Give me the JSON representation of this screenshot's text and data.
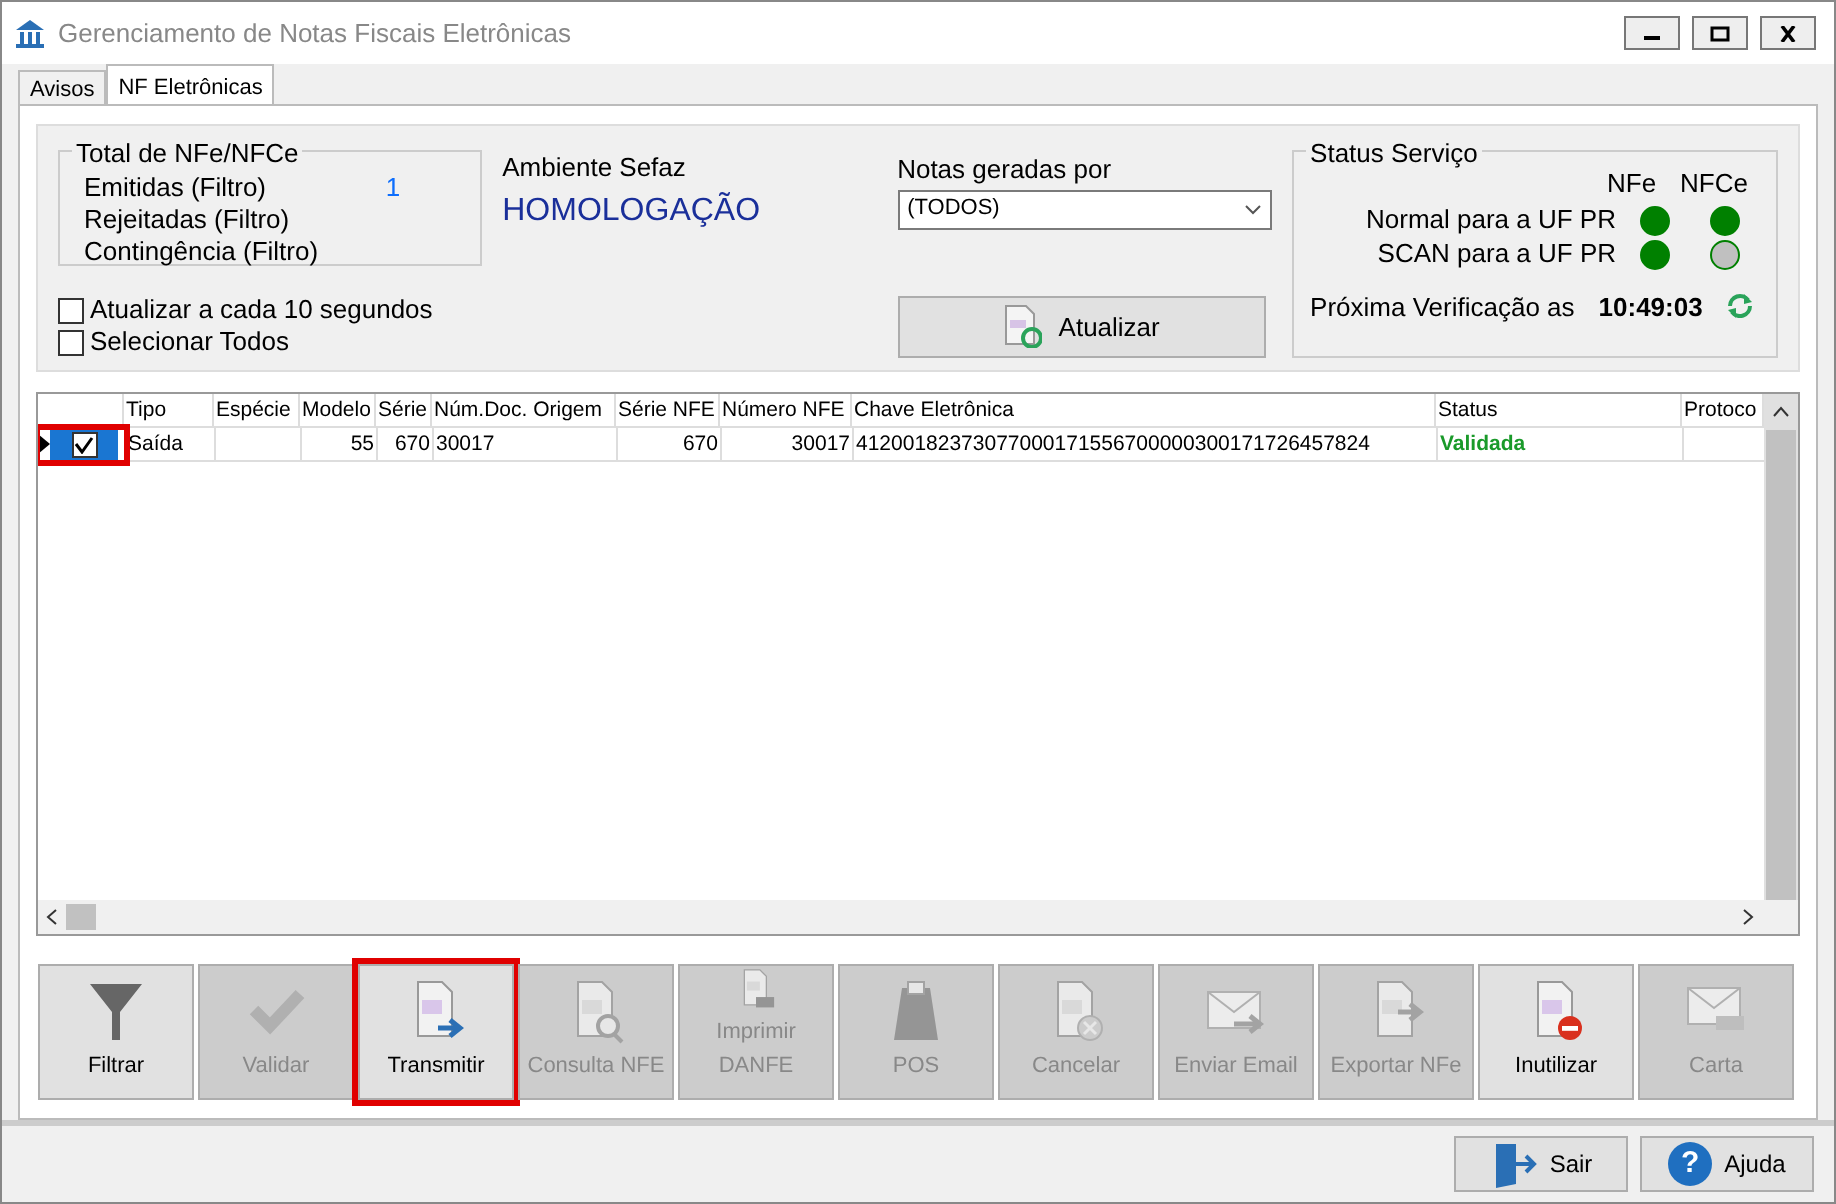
{
  "window": {
    "title": "Gerenciamento de Notas Fiscais Eletrônicas"
  },
  "tabs": [
    {
      "label": "Avisos",
      "selected": false
    },
    {
      "label": "NF Eletrônicas",
      "selected": true
    }
  ],
  "totals": {
    "title": "Total de NFe/NFCe",
    "rows": [
      {
        "label": "Emitidas (Filtro)",
        "value": "1"
      },
      {
        "label": "Rejeitadas (Filtro)"
      },
      {
        "label": "Contingência (Filtro)"
      }
    ]
  },
  "ambiente": {
    "label": "Ambiente Sefaz",
    "value": "HOMOLOGAÇÃO"
  },
  "notas_geradas": {
    "label": "Notas geradas por",
    "value": "(TODOS)"
  },
  "options": [
    {
      "label": "Atualizar a cada 10 segundos",
      "checked": false
    },
    {
      "label": "Selecionar Todos",
      "checked": false
    }
  ],
  "atualizar_button": "Atualizar",
  "status_servico": {
    "title": "Status Serviço",
    "headers": [
      "NFe",
      "NFCe"
    ],
    "rows": [
      {
        "label": "Normal para a UF PR",
        "dots": [
          {
            "color": "#008000"
          },
          {
            "color": "#008000"
          }
        ]
      },
      {
        "label": "SCAN para a UF PR",
        "dots": [
          {
            "color": "#008000"
          },
          {
            "color": "#c0c0c0"
          }
        ]
      }
    ],
    "next_check_label": "Próxima Verificação as",
    "next_check_time": "10:49:03"
  },
  "table": {
    "columns": [
      {
        "label": "Tipo"
      },
      {
        "label": "Espécie"
      },
      {
        "label": "Modelo"
      },
      {
        "label": "Série"
      },
      {
        "label": "Núm.Doc. Origem"
      },
      {
        "label": "Série NFE"
      },
      {
        "label": "Número NFE"
      },
      {
        "label": "Chave Eletrônica"
      },
      {
        "label": "Status"
      },
      {
        "label": "Protoco"
      }
    ],
    "rows": [
      {
        "current": true,
        "checked": true,
        "highlighted": true,
        "cells": [
          "Saída",
          "",
          "55",
          "670",
          "30017",
          "670",
          "30017",
          "41200182373077000171556700000300171726457824",
          "Validada",
          ""
        ]
      }
    ]
  },
  "toolbar": [
    {
      "kind": "filter",
      "label": "Filtrar",
      "disabled": false,
      "highlighted": false
    },
    {
      "kind": "check",
      "label": "Validar",
      "disabled": true,
      "highlighted": false
    },
    {
      "kind": "send",
      "label": "Transmitir",
      "disabled": false,
      "highlighted": true
    },
    {
      "kind": "search",
      "label": "Consulta NFE",
      "disabled": true,
      "highlighted": false
    },
    {
      "kind": "print",
      "label": "Imprimir DANFE",
      "disabled": true,
      "highlighted": false
    },
    {
      "kind": "pos",
      "label": "POS",
      "disabled": true,
      "highlighted": false
    },
    {
      "kind": "cancel",
      "label": "Cancelar",
      "disabled": true,
      "highlighted": false
    },
    {
      "kind": "mail",
      "label": "Enviar Email",
      "disabled": true,
      "highlighted": false
    },
    {
      "kind": "export",
      "label": "Exportar NFe",
      "disabled": true,
      "highlighted": false
    },
    {
      "kind": "block",
      "label": "Inutilizar",
      "disabled": false,
      "highlighted": false
    },
    {
      "kind": "card",
      "label": "Carta",
      "disabled": true,
      "highlighted": false
    }
  ],
  "footer_buttons": [
    {
      "kind": "exit",
      "label": "Sair"
    },
    {
      "kind": "help",
      "label": "Ajuda",
      "icon_text": "?"
    }
  ]
}
